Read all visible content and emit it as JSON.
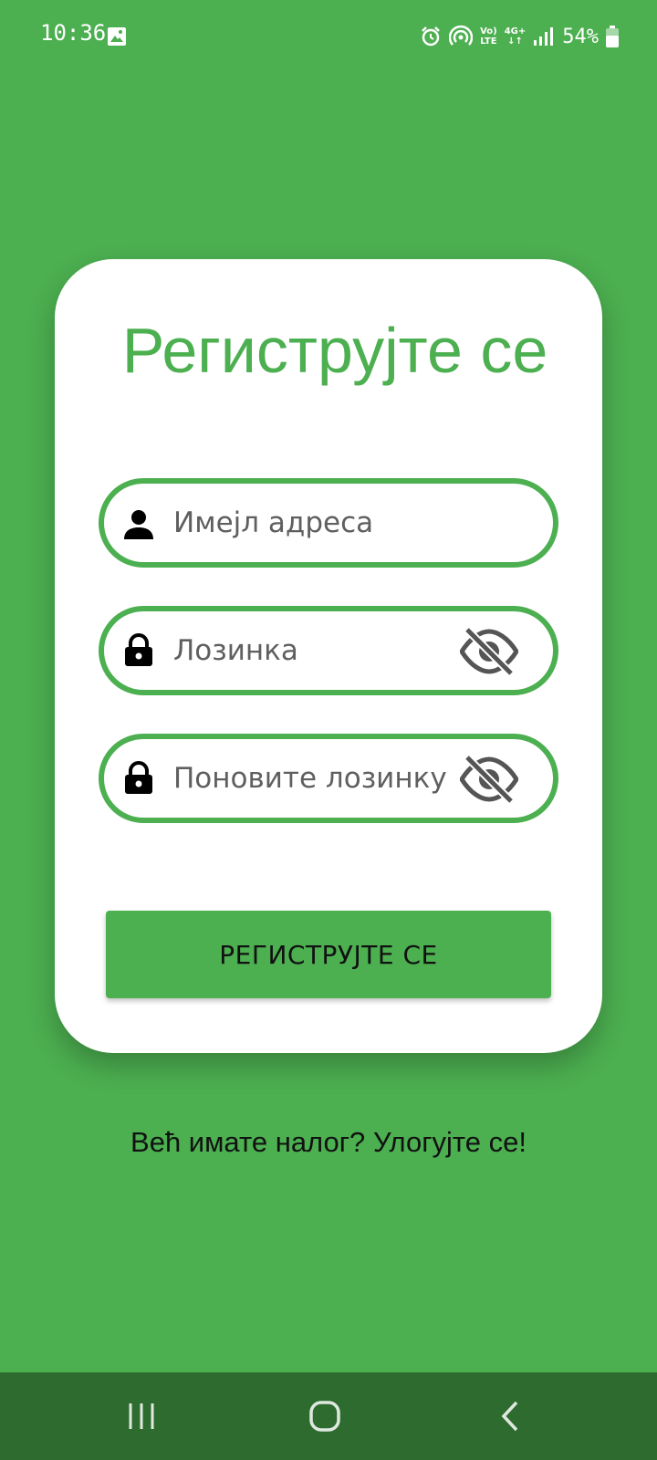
{
  "status_bar": {
    "time": "10:36",
    "net_top": "Vo)",
    "net_bottom": "LTE",
    "gen_top": "4G+",
    "gen_bottom": "↓↑",
    "battery": "54%",
    "icons": [
      "gallery-icon",
      "alarm-icon",
      "hotspot-icon",
      "signal-icon",
      "battery-icon"
    ]
  },
  "form": {
    "title": "Региструјте се",
    "email_placeholder": "Имејл адреса",
    "password_placeholder": "Лозинка",
    "confirm_password_placeholder": "Поновите лозинку",
    "submit_label": "РЕГИСТРУЈТЕ СЕ"
  },
  "login_link": "Већ имате налог? Улогујте се!",
  "colors": {
    "background": "#4caf50",
    "card": "#ffffff",
    "nav_bar": "#2e6b2f",
    "field_border": "#4caf50"
  }
}
